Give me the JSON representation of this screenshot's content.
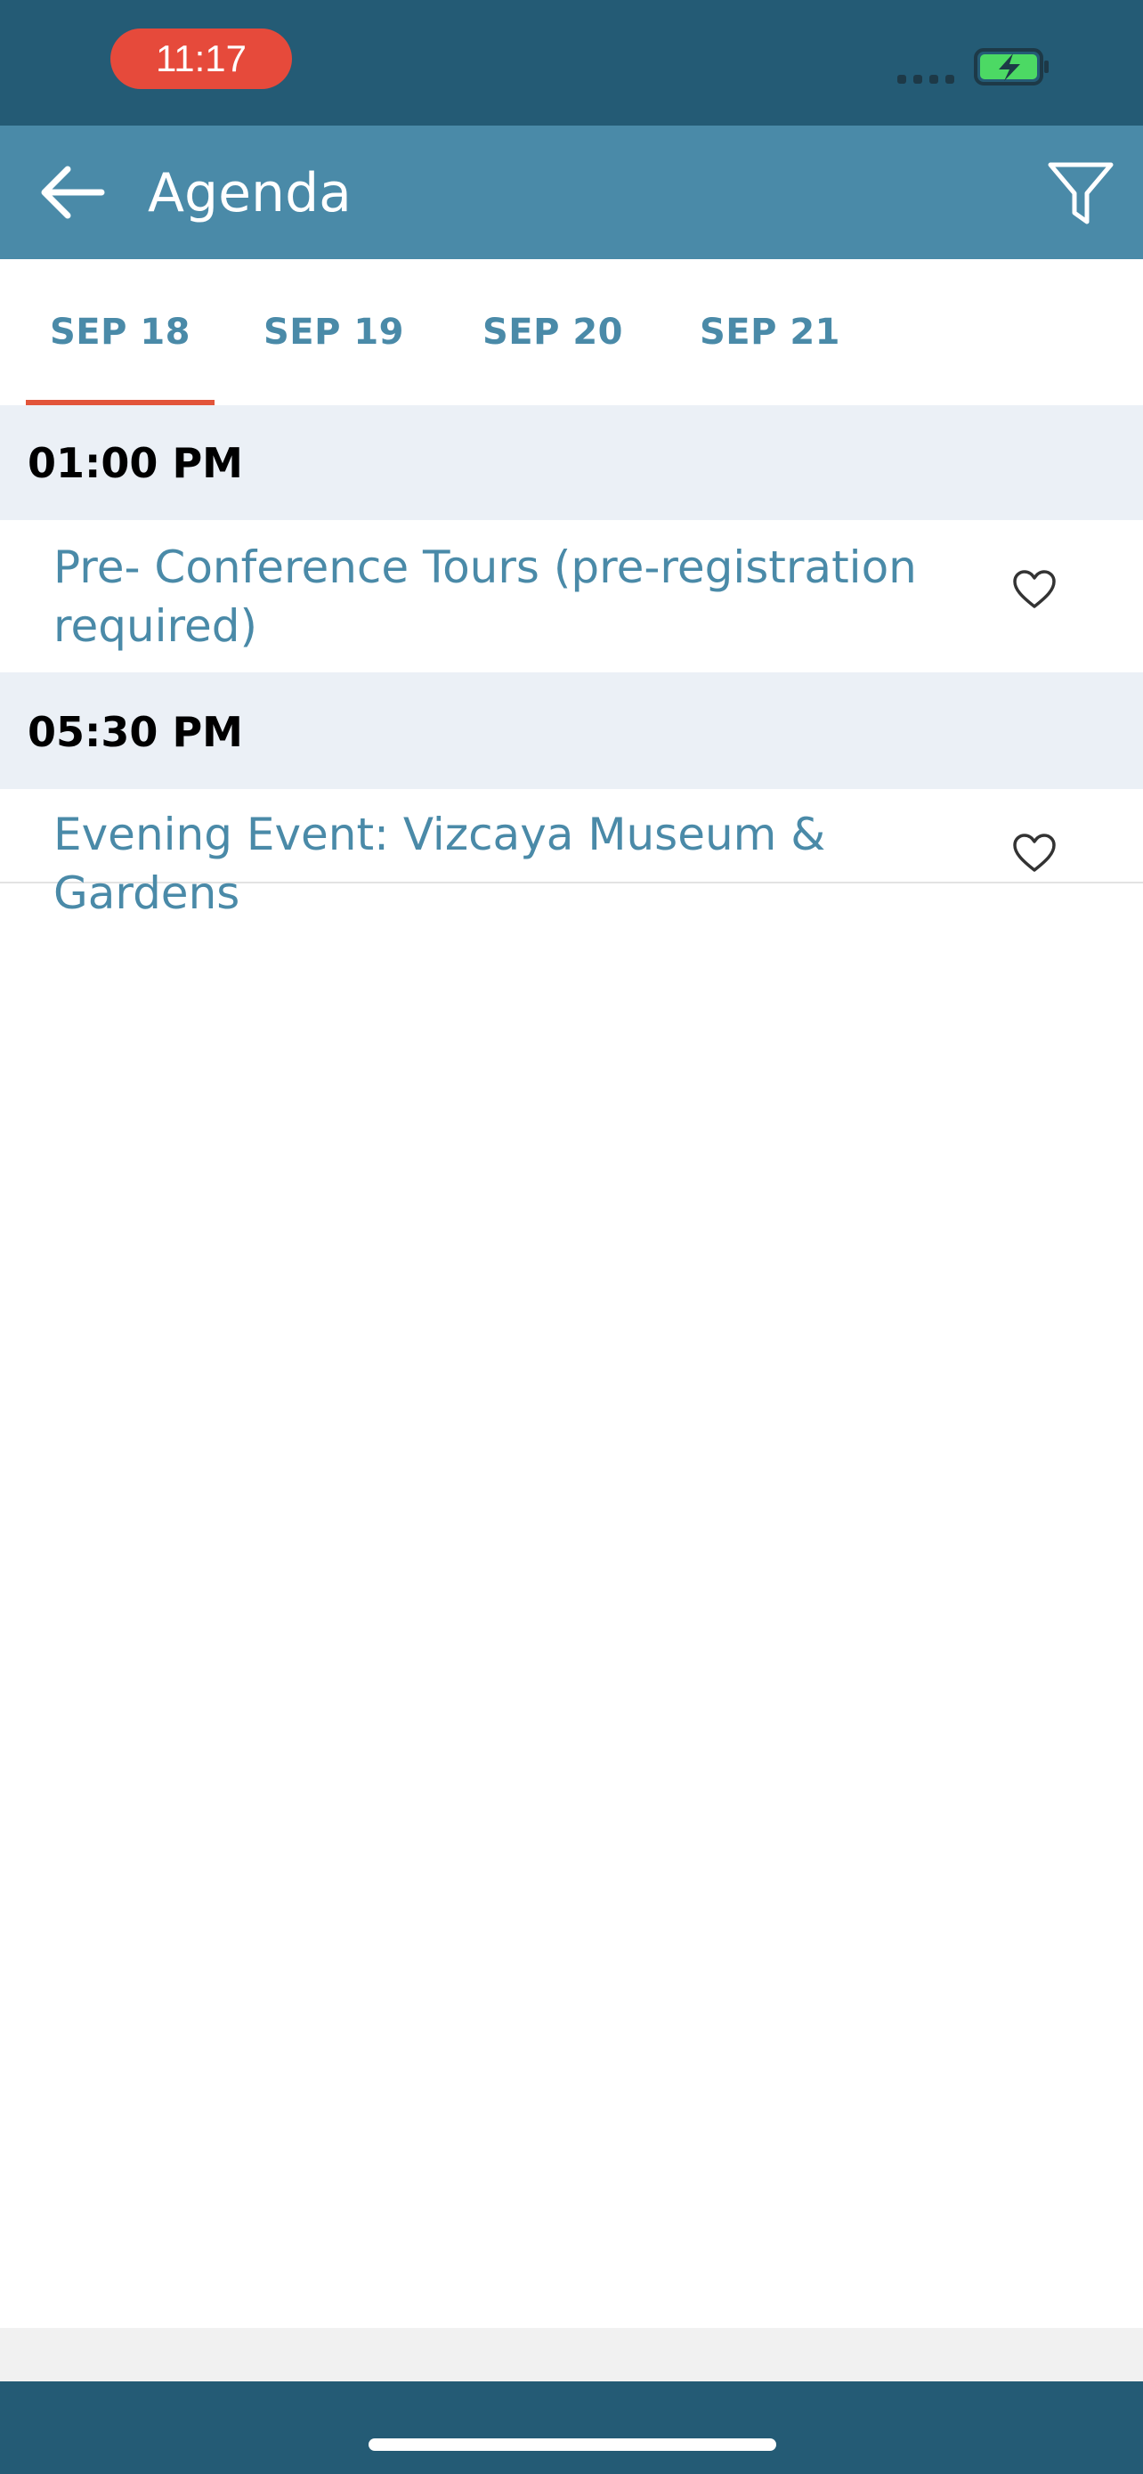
{
  "status_bar": {
    "time": "11:17",
    "time_pill_color": "#e64a3b",
    "background": "#245b75",
    "battery_icon": "battery-charging-icon",
    "signal_icon": "signal-icon"
  },
  "app_bar": {
    "title": "Agenda",
    "background": "#4a8aa8",
    "back_icon": "arrow-left-icon",
    "filter_icon": "filter-icon"
  },
  "tabs": {
    "active_index": 0,
    "indicator_color": "#e2553a",
    "items": [
      {
        "label": "SEP 18"
      },
      {
        "label": "SEP 19"
      },
      {
        "label": "SEP 20"
      },
      {
        "label": "SEP 21"
      }
    ]
  },
  "agenda": {
    "sections": [
      {
        "time": "01:00 PM",
        "sessions": [
          {
            "title": "Pre- Conference Tours (pre-registration required)",
            "favorite": false
          }
        ]
      },
      {
        "time": "05:30 PM",
        "sessions": [
          {
            "title": "Evening Event: Vizcaya Museum & Gardens",
            "favorite": false
          }
        ]
      }
    ]
  }
}
